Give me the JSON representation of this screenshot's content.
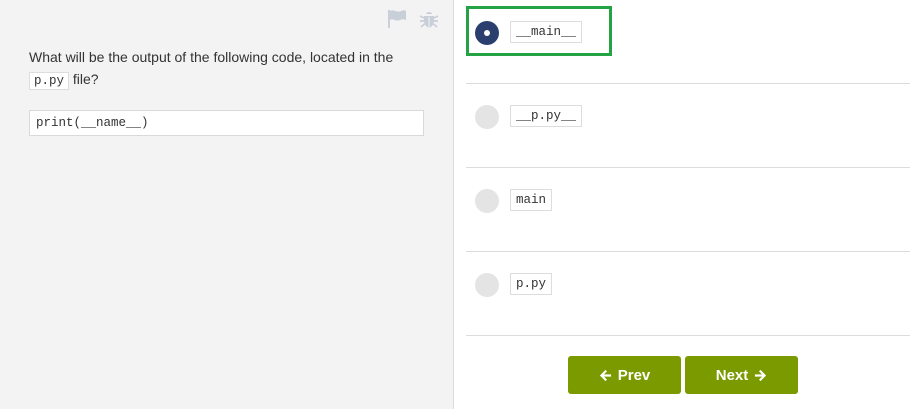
{
  "question": {
    "text_before": "What will be the output of the following code, located in the ",
    "file_code": "p.py",
    "text_after": " file?",
    "code": "print(__name__)"
  },
  "options": [
    {
      "code": "__main__",
      "selected": true
    },
    {
      "code": "__p.py__",
      "selected": false
    },
    {
      "code": "main",
      "selected": false
    },
    {
      "code": "p.py",
      "selected": false
    }
  ],
  "nav": {
    "prev_label": "Prev",
    "next_label": "Next"
  },
  "icons": {
    "flag": "flag-icon",
    "bug": "bug-icon",
    "prev": "arrow-left-icon",
    "next": "arrow-right-icon"
  },
  "colors": {
    "button_bg": "#7a9a00",
    "radio_selected": "#2b3f6e",
    "radio_unselected": "#e4e4e4",
    "highlight": "#25a244",
    "left_panel_bg": "#f3f3f3"
  }
}
